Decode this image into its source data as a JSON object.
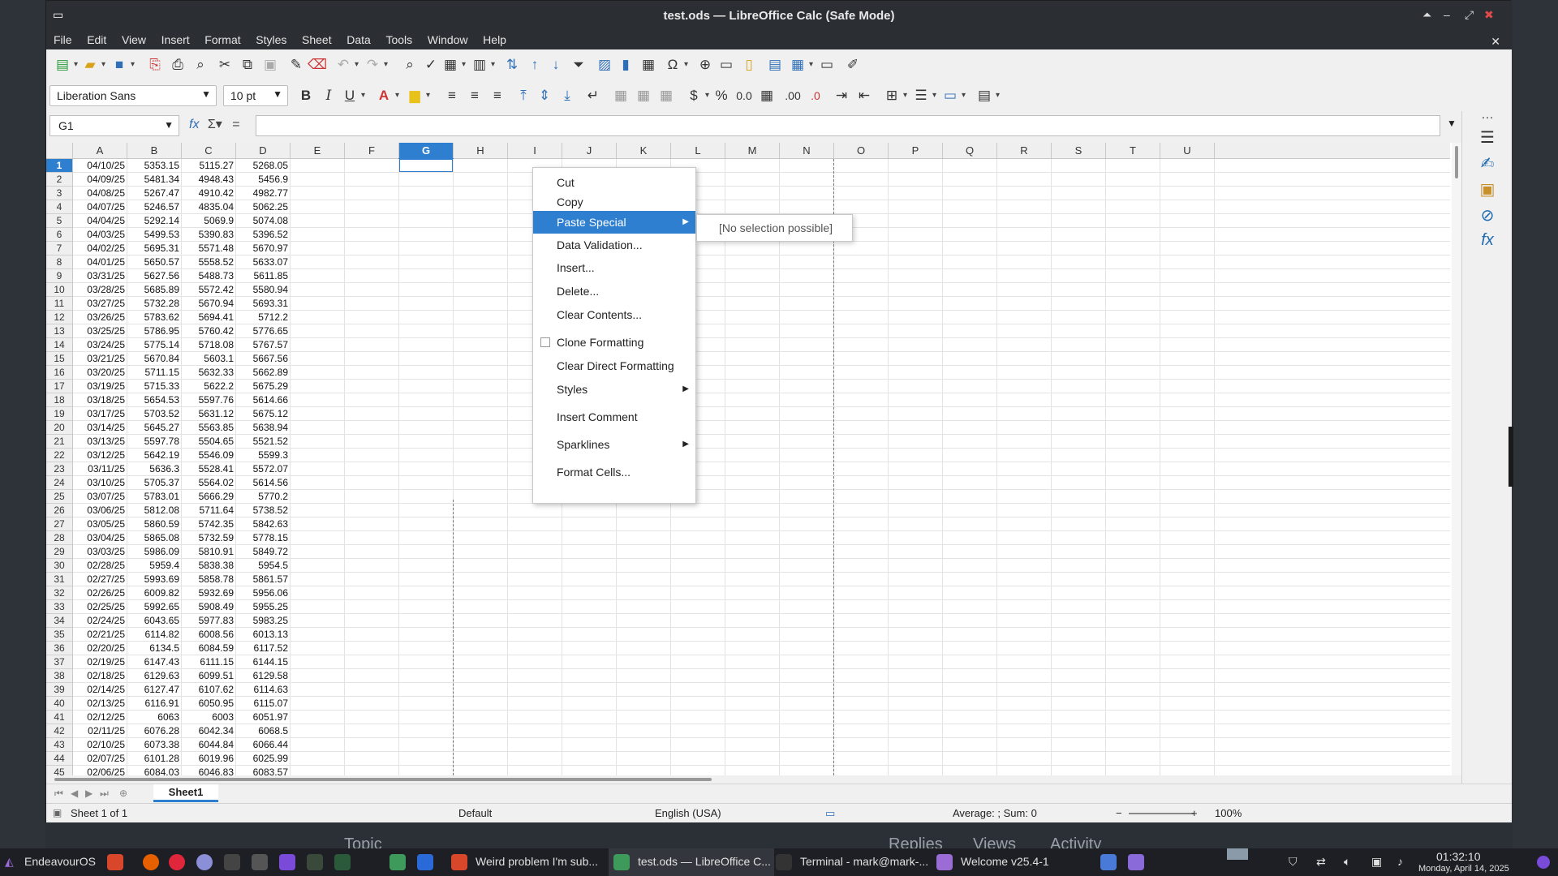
{
  "window": {
    "title": "test.ods — LibreOffice Calc (Safe Mode)"
  },
  "menubar": [
    "File",
    "Edit",
    "View",
    "Insert",
    "Format",
    "Styles",
    "Sheet",
    "Data",
    "Tools",
    "Window",
    "Help"
  ],
  "font_name": "Liberation Sans",
  "font_size": "10 pt",
  "name_box": "G1",
  "columns": [
    "A",
    "B",
    "C",
    "D",
    "E",
    "F",
    "G",
    "H",
    "I",
    "J",
    "K",
    "L",
    "M",
    "N",
    "O",
    "P",
    "Q",
    "R",
    "S",
    "T",
    "U"
  ],
  "selected_column": "G",
  "rows": [
    [
      "04/10/25",
      "5353.15",
      "5115.27",
      "5268.05"
    ],
    [
      "04/09/25",
      "5481.34",
      "4948.43",
      "5456.9"
    ],
    [
      "04/08/25",
      "5267.47",
      "4910.42",
      "4982.77"
    ],
    [
      "04/07/25",
      "5246.57",
      "4835.04",
      "5062.25"
    ],
    [
      "04/04/25",
      "5292.14",
      "5069.9",
      "5074.08"
    ],
    [
      "04/03/25",
      "5499.53",
      "5390.83",
      "5396.52"
    ],
    [
      "04/02/25",
      "5695.31",
      "5571.48",
      "5670.97"
    ],
    [
      "04/01/25",
      "5650.57",
      "5558.52",
      "5633.07"
    ],
    [
      "03/31/25",
      "5627.56",
      "5488.73",
      "5611.85"
    ],
    [
      "03/28/25",
      "5685.89",
      "5572.42",
      "5580.94"
    ],
    [
      "03/27/25",
      "5732.28",
      "5670.94",
      "5693.31"
    ],
    [
      "03/26/25",
      "5783.62",
      "5694.41",
      "5712.2"
    ],
    [
      "03/25/25",
      "5786.95",
      "5760.42",
      "5776.65"
    ],
    [
      "03/24/25",
      "5775.14",
      "5718.08",
      "5767.57"
    ],
    [
      "03/21/25",
      "5670.84",
      "5603.1",
      "5667.56"
    ],
    [
      "03/20/25",
      "5711.15",
      "5632.33",
      "5662.89"
    ],
    [
      "03/19/25",
      "5715.33",
      "5622.2",
      "5675.29"
    ],
    [
      "03/18/25",
      "5654.53",
      "5597.76",
      "5614.66"
    ],
    [
      "03/17/25",
      "5703.52",
      "5631.12",
      "5675.12"
    ],
    [
      "03/14/25",
      "5645.27",
      "5563.85",
      "5638.94"
    ],
    [
      "03/13/25",
      "5597.78",
      "5504.65",
      "5521.52"
    ],
    [
      "03/12/25",
      "5642.19",
      "5546.09",
      "5599.3"
    ],
    [
      "03/11/25",
      "5636.3",
      "5528.41",
      "5572.07"
    ],
    [
      "03/10/25",
      "5705.37",
      "5564.02",
      "5614.56"
    ],
    [
      "03/07/25",
      "5783.01",
      "5666.29",
      "5770.2"
    ],
    [
      "03/06/25",
      "5812.08",
      "5711.64",
      "5738.52"
    ],
    [
      "03/05/25",
      "5860.59",
      "5742.35",
      "5842.63"
    ],
    [
      "03/04/25",
      "5865.08",
      "5732.59",
      "5778.15"
    ],
    [
      "03/03/25",
      "5986.09",
      "5810.91",
      "5849.72"
    ],
    [
      "02/28/25",
      "5959.4",
      "5838.38",
      "5954.5"
    ],
    [
      "02/27/25",
      "5993.69",
      "5858.78",
      "5861.57"
    ],
    [
      "02/26/25",
      "6009.82",
      "5932.69",
      "5956.06"
    ],
    [
      "02/25/25",
      "5992.65",
      "5908.49",
      "5955.25"
    ],
    [
      "02/24/25",
      "6043.65",
      "5977.83",
      "5983.25"
    ],
    [
      "02/21/25",
      "6114.82",
      "6008.56",
      "6013.13"
    ],
    [
      "02/20/25",
      "6134.5",
      "6084.59",
      "6117.52"
    ],
    [
      "02/19/25",
      "6147.43",
      "6111.15",
      "6144.15"
    ],
    [
      "02/18/25",
      "6129.63",
      "6099.51",
      "6129.58"
    ],
    [
      "02/14/25",
      "6127.47",
      "6107.62",
      "6114.63"
    ],
    [
      "02/13/25",
      "6116.91",
      "6050.95",
      "6115.07"
    ],
    [
      "02/12/25",
      "6063",
      "6003",
      "6051.97"
    ],
    [
      "02/11/25",
      "6076.28",
      "6042.34",
      "6068.5"
    ],
    [
      "02/10/25",
      "6073.38",
      "6044.84",
      "6066.44"
    ],
    [
      "02/07/25",
      "6101.28",
      "6019.96",
      "6025.99"
    ],
    [
      "02/06/25",
      "6084.03",
      "6046.83",
      "6083.57"
    ]
  ],
  "context_menu": {
    "items": [
      "Cut",
      "Copy",
      "Paste Special",
      "Data Validation...",
      "Insert...",
      "Delete...",
      "Clear Contents...",
      "Clone Formatting",
      "Clear Direct Formatting",
      "Styles",
      "Insert Comment",
      "Sparklines",
      "Format Cells..."
    ],
    "highlighted": "Paste Special"
  },
  "submenu": {
    "text": "[No selection possible]"
  },
  "sheet_tab": "Sheet1",
  "status": {
    "sheet": "Sheet 1 of 1",
    "style": "Default",
    "language": "English (USA)",
    "summary": "Average: ; Sum: 0",
    "zoom": "100%"
  },
  "taskbar": {
    "start": "EndeavourOS",
    "tasks": [
      "Weird problem I'm sub...",
      "test.ods — LibreOffice C...",
      "Terminal - mark@mark-...",
      "Welcome v25.4-1"
    ],
    "time": "01:32:10",
    "date": "Monday, April 14, 2025"
  },
  "background": {
    "bottom_words": [
      "Topic",
      "Replies",
      "Views",
      "Activity"
    ]
  }
}
